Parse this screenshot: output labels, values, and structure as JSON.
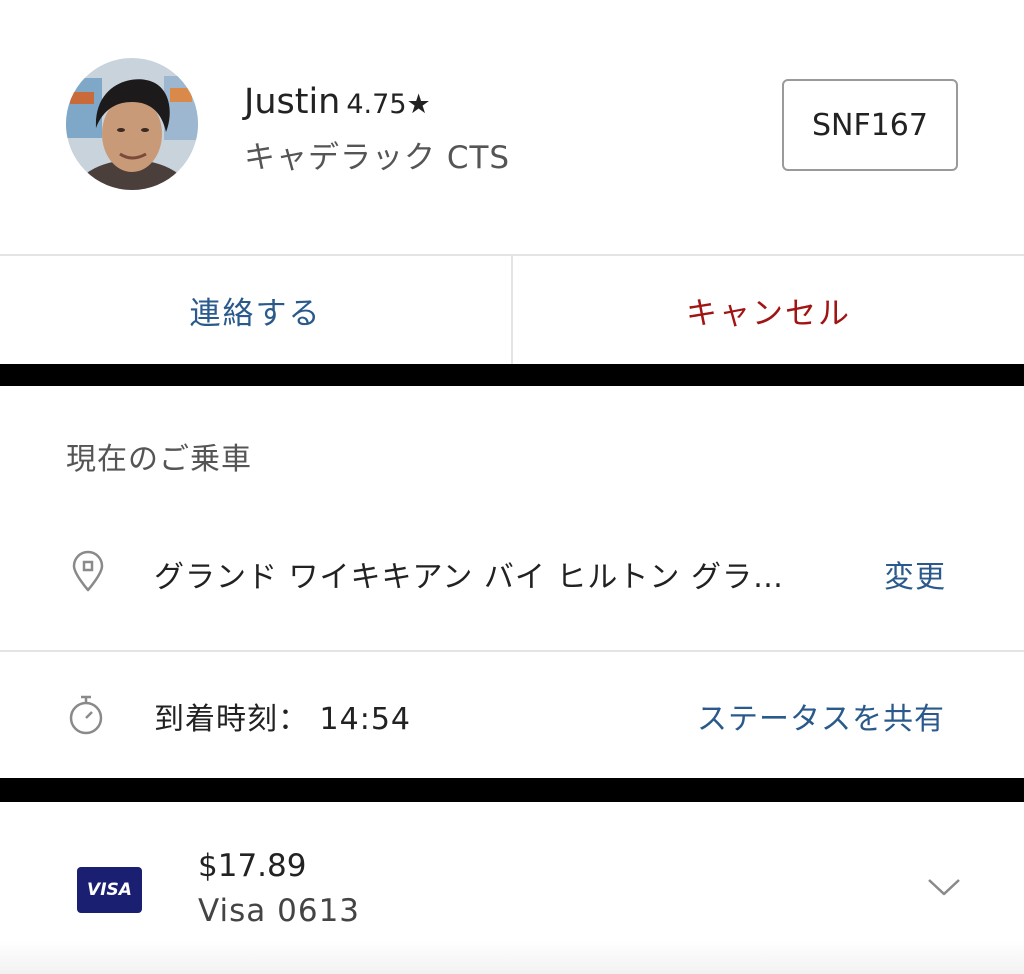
{
  "driver": {
    "name": "Justin",
    "rating": "4.75★",
    "car": "キャデラック CTS",
    "plate": "SNF167"
  },
  "actions": {
    "contact_label": "連絡する",
    "cancel_label": "キャンセル"
  },
  "trip": {
    "section_title": "現在のご乗車",
    "destination": "グランド ワイキキアン バイ ヒルトン グラ…",
    "change_label": "変更",
    "eta_label": "到着時刻：",
    "eta_time": "14:54",
    "share_label": "ステータスを共有"
  },
  "payment": {
    "card_brand": "VISA",
    "amount": "$17.89",
    "card_label": "Visa 0613"
  },
  "icons": {
    "destination": "location-pin-icon",
    "eta": "stopwatch-icon",
    "expand": "chevron-down-icon"
  },
  "colors": {
    "link_blue": "#2a5a8c",
    "cancel_red": "#a11414",
    "visa_navy": "#1a1f71"
  }
}
